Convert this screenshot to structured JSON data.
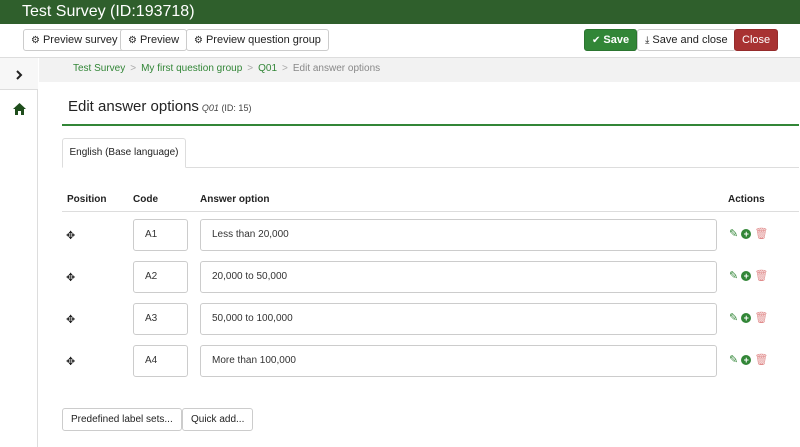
{
  "window": {
    "title": "Test Survey (ID:193718)"
  },
  "toolbar": {
    "preview_survey": "Preview survey",
    "preview": "Preview",
    "preview_question_group": "Preview question group",
    "save": "Save",
    "save_and_close": "Save and close",
    "close": "Close"
  },
  "sidebar": {
    "toggle_icon": "chevron-right-icon",
    "home_icon": "home-icon"
  },
  "breadcrumb": {
    "items": [
      "Test Survey",
      "My first question group",
      "Q01"
    ],
    "separator": ">",
    "current": "Edit answer options"
  },
  "page": {
    "title": "Edit answer options",
    "question_code": "Q01",
    "question_id": "(ID: 15)"
  },
  "tabs": [
    {
      "label": "English (Base language)",
      "active": true
    }
  ],
  "table": {
    "headers": {
      "position": "Position",
      "code": "Code",
      "answer": "Answer option",
      "actions": "Actions"
    },
    "rows": [
      {
        "code": "A1",
        "answer": "Less than 20,000"
      },
      {
        "code": "A2",
        "answer": "20,000 to 50,000"
      },
      {
        "code": "A3",
        "answer": "50,000 to 100,000"
      },
      {
        "code": "A4",
        "answer": "More than 100,000"
      }
    ]
  },
  "buttons": {
    "predefined_label_sets": "Predefined label sets...",
    "quick_add": "Quick add..."
  },
  "colors": {
    "brand_green": "#328637",
    "header_green": "#2f5f2c",
    "close_red": "#a83232"
  }
}
